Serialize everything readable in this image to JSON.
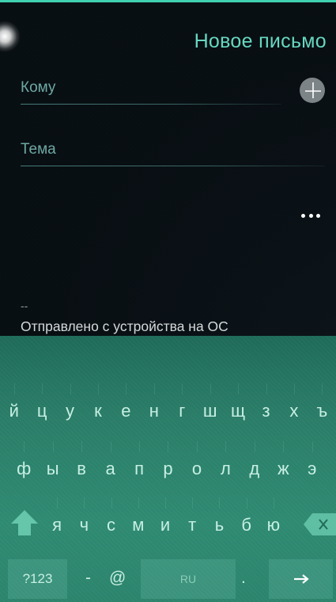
{
  "compose": {
    "title": "Новое письмо",
    "to_placeholder": "Кому",
    "subject_placeholder": "Тема",
    "signature_separator": "--",
    "signature_text": "Отправлено с устройства на ОС"
  },
  "icons": {
    "add_contact": "add-contact-icon",
    "more": "more-options-icon",
    "shift": "shift-arrow-icon",
    "backspace": "backspace-icon",
    "enter": "enter-arrow-icon"
  },
  "colors": {
    "accent": "#3fd1b0",
    "title": "#67d7c0",
    "keyboard": "#2a7d68"
  },
  "keyboard": {
    "row1": [
      "й",
      "ц",
      "у",
      "к",
      "е",
      "н",
      "г",
      "ш",
      "щ",
      "з",
      "х",
      "ъ"
    ],
    "row2": [
      "ф",
      "ы",
      "в",
      "а",
      "п",
      "р",
      "о",
      "л",
      "д",
      "ж",
      "э"
    ],
    "row3": [
      "я",
      "ч",
      "с",
      "м",
      "и",
      "т",
      "ь",
      "б",
      "ю"
    ],
    "symbols_label": "?123",
    "dash_label": "-",
    "at_label": "@",
    "space_label": "RU",
    "period_label": "."
  }
}
